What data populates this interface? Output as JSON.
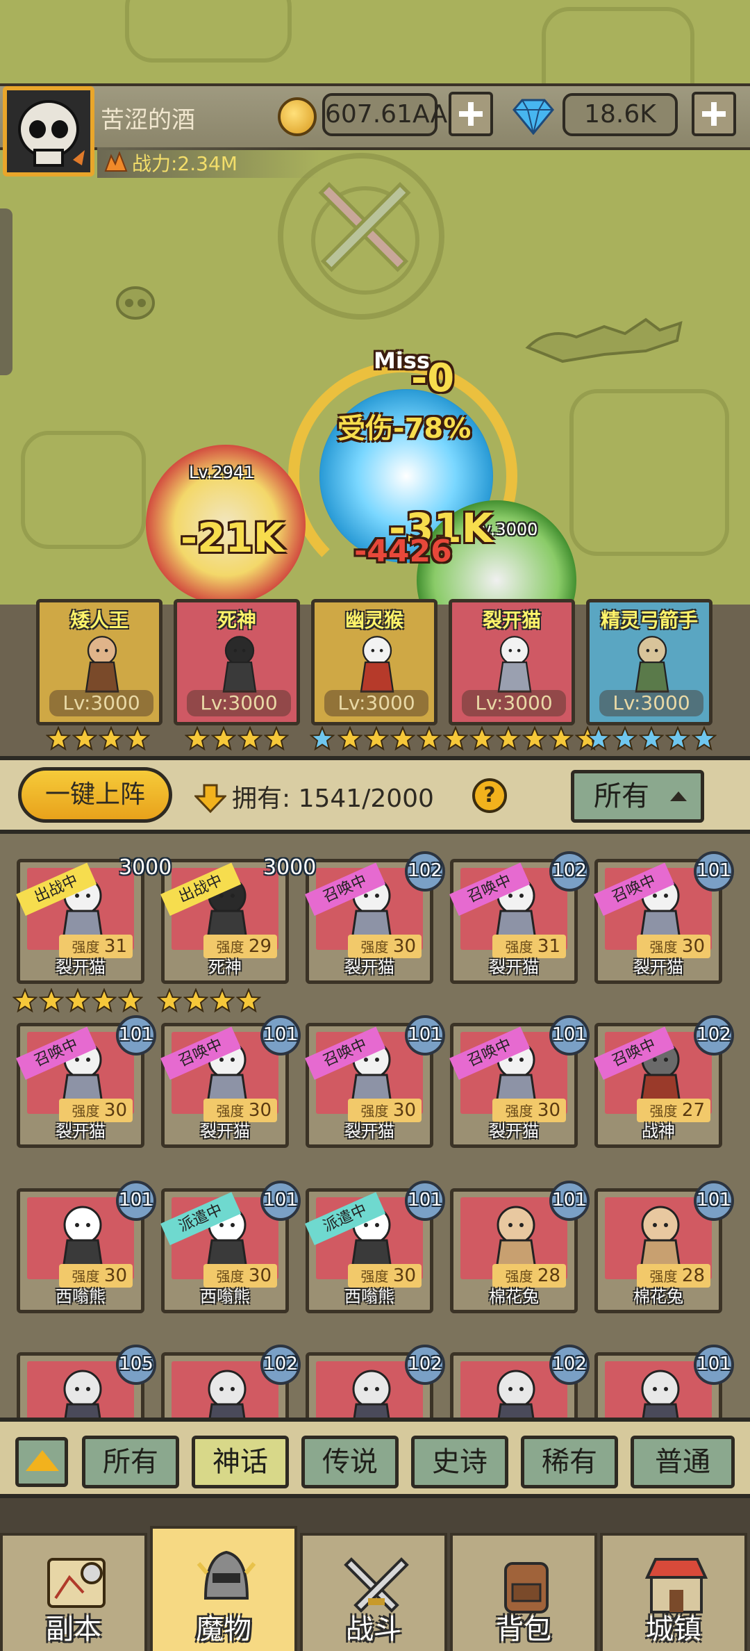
{
  "player": {
    "name": "苦涩的酒",
    "power": "战力:2.34M",
    "gold": "607.61AA",
    "gems": "18.6K"
  },
  "battle": {
    "miss": "Miss",
    "dmg_zero": "-0",
    "dmg_reduction": "受伤-78%",
    "dmg_left": "-21K",
    "dmg_mid": "-31K",
    "dmg_crit": "-4426",
    "lv_left": "Lv.2941",
    "lv_right": "Lv.3000"
  },
  "lineup": [
    {
      "name": "矮人王",
      "lv": "Lv:3000",
      "bg": "#cfa845",
      "stars": 4,
      "star_color": "#f6c83a"
    },
    {
      "name": "死神",
      "lv": "Lv:3000",
      "bg": "#cf5964",
      "stars": 4,
      "star_color": "#f6c83a"
    },
    {
      "name": "幽灵猴",
      "lv": "Lv:3000",
      "bg": "#cfa845",
      "stars": 1,
      "star_color": "#6fc7ef"
    },
    {
      "name": "裂开猫",
      "lv": "Lv:3000",
      "bg": "#cf5964",
      "stars": 0,
      "star_color": "#f6c83a"
    },
    {
      "name": "精灵弓箭手",
      "lv": "Lv:3000",
      "bg": "#5aa6c2",
      "stars": 5,
      "star_color": "#6fc7ef"
    }
  ],
  "controls": {
    "deploy_label": "一键上阵",
    "own_label": "拥有:",
    "own_count": "1541/2000",
    "help": "?",
    "filter_label": "所有"
  },
  "inventory": [
    {
      "name": "裂开猫",
      "strength_label": "强度",
      "strength": "31",
      "level": "3000",
      "ribbon": "出战中",
      "ribbon_type": "battle",
      "stars": 5
    },
    {
      "name": "死神",
      "strength_label": "强度",
      "strength": "29",
      "level": "3000",
      "ribbon": "出战中",
      "ribbon_type": "battle",
      "stars": 4
    },
    {
      "name": "裂开猫",
      "strength_label": "强度",
      "strength": "30",
      "level": "102",
      "ribbon": "召唤中",
      "ribbon_type": "summon",
      "stars": 0
    },
    {
      "name": "裂开猫",
      "strength_label": "强度",
      "strength": "31",
      "level": "102",
      "ribbon": "召唤中",
      "ribbon_type": "summon",
      "stars": 0
    },
    {
      "name": "裂开猫",
      "strength_label": "强度",
      "strength": "30",
      "level": "101",
      "ribbon": "召唤中",
      "ribbon_type": "summon",
      "stars": 0
    },
    {
      "name": "裂开猫",
      "strength_label": "强度",
      "strength": "30",
      "level": "101",
      "ribbon": "召唤中",
      "ribbon_type": "summon",
      "stars": 0
    },
    {
      "name": "裂开猫",
      "strength_label": "强度",
      "strength": "30",
      "level": "101",
      "ribbon": "召唤中",
      "ribbon_type": "summon",
      "stars": 0
    },
    {
      "name": "裂开猫",
      "strength_label": "强度",
      "strength": "30",
      "level": "101",
      "ribbon": "召唤中",
      "ribbon_type": "summon",
      "stars": 0
    },
    {
      "name": "裂开猫",
      "strength_label": "强度",
      "strength": "30",
      "level": "101",
      "ribbon": "召唤中",
      "ribbon_type": "summon",
      "stars": 0
    },
    {
      "name": "战神",
      "strength_label": "强度",
      "strength": "27",
      "level": "102",
      "ribbon": "召唤中",
      "ribbon_type": "summon",
      "stars": 0
    },
    {
      "name": "西嗡熊",
      "strength_label": "强度",
      "strength": "30",
      "level": "101",
      "ribbon": "",
      "ribbon_type": "",
      "stars": 0
    },
    {
      "name": "西嗡熊",
      "strength_label": "强度",
      "strength": "30",
      "level": "101",
      "ribbon": "派遣中",
      "ribbon_type": "dispatch",
      "stars": 0
    },
    {
      "name": "西嗡熊",
      "strength_label": "强度",
      "strength": "30",
      "level": "101",
      "ribbon": "派遣中",
      "ribbon_type": "dispatch",
      "stars": 0
    },
    {
      "name": "棉花兔",
      "strength_label": "强度",
      "strength": "28",
      "level": "101",
      "ribbon": "",
      "ribbon_type": "",
      "stars": 0
    },
    {
      "name": "棉花兔",
      "strength_label": "强度",
      "strength": "28",
      "level": "101",
      "ribbon": "",
      "ribbon_type": "",
      "stars": 0
    },
    {
      "name": "",
      "strength_label": "",
      "strength": "",
      "level": "105",
      "ribbon": "",
      "ribbon_type": "",
      "stars": 0
    },
    {
      "name": "",
      "strength_label": "",
      "strength": "",
      "level": "102",
      "ribbon": "",
      "ribbon_type": "",
      "stars": 0
    },
    {
      "name": "",
      "strength_label": "",
      "strength": "",
      "level": "102",
      "ribbon": "",
      "ribbon_type": "",
      "stars": 0
    },
    {
      "name": "",
      "strength_label": "",
      "strength": "",
      "level": "102",
      "ribbon": "",
      "ribbon_type": "",
      "stars": 0
    },
    {
      "name": "",
      "strength_label": "",
      "strength": "",
      "level": "101",
      "ribbon": "",
      "ribbon_type": "",
      "stars": 0
    }
  ],
  "rarity_tabs": [
    "所有",
    "神话",
    "传说",
    "史诗",
    "稀有",
    "普通"
  ],
  "rarity_active": "神话",
  "nav": [
    {
      "label": "副本",
      "icon": "map-icon"
    },
    {
      "label": "魔物",
      "icon": "helmet-icon"
    },
    {
      "label": "战斗",
      "icon": "crossed-swords-icon"
    },
    {
      "label": "背包",
      "icon": "backpack-icon"
    },
    {
      "label": "城镇",
      "icon": "shop-icon"
    }
  ],
  "nav_active": "魔物"
}
